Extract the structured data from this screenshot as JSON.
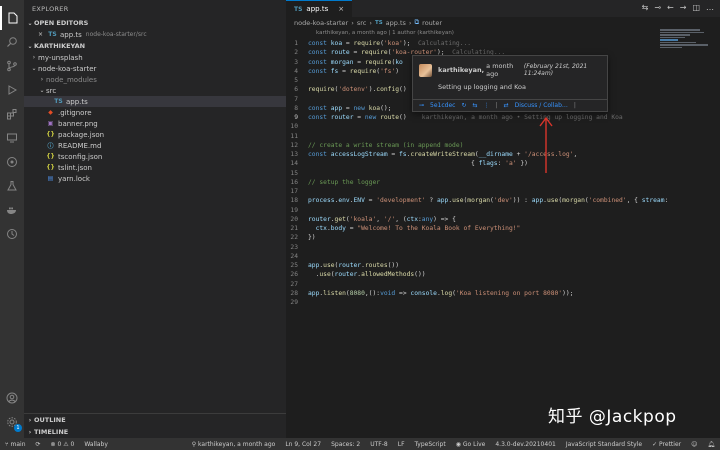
{
  "sidebar": {
    "title": "EXPLORER",
    "open_editors_label": "OPEN EDITORS",
    "open_file": {
      "name": "app.ts",
      "path": "node-koa-starter/src"
    },
    "workspace_label": "KARTHIKEYAN",
    "tree": [
      {
        "label": "my-unsplash",
        "kind": "folder",
        "depth": 1,
        "caret": "›"
      },
      {
        "label": "node-koa-starter",
        "kind": "folder",
        "depth": 1,
        "caret": "⌄"
      },
      {
        "label": "node_modules",
        "kind": "folder",
        "depth": 2,
        "caret": "›",
        "dim": true
      },
      {
        "label": "src",
        "kind": "folder",
        "depth": 2,
        "caret": "⌄"
      },
      {
        "label": "app.ts",
        "kind": "ts",
        "depth": 3,
        "selected": true
      },
      {
        "label": ".gitignore",
        "kind": "git",
        "depth": 2
      },
      {
        "label": "banner.png",
        "kind": "image",
        "depth": 2
      },
      {
        "label": "package.json",
        "kind": "json",
        "depth": 2
      },
      {
        "label": "README.md",
        "kind": "info",
        "depth": 2
      },
      {
        "label": "tsconfig.json",
        "kind": "json",
        "depth": 2
      },
      {
        "label": "tslint.json",
        "kind": "json",
        "depth": 2
      },
      {
        "label": "yarn.lock",
        "kind": "lock",
        "depth": 2
      }
    ],
    "outline_label": "OUTLINE",
    "timeline_label": "TIMELINE"
  },
  "editor": {
    "tab_label": "app.ts",
    "tab_close": "×",
    "breadcrumb": [
      "node-koa-starter",
      "src",
      "app.ts",
      "router"
    ],
    "blame_header": "karthikeyan, a month ago | 1 author (karthikeyan)",
    "lines": [
      {
        "n": "1",
        "t": "const koa = require('koa');  Calculating..."
      },
      {
        "n": "2",
        "t": "const route = require('koa-router');  Calculating..."
      },
      {
        "n": "3",
        "t": "const morgan = require('ko"
      },
      {
        "n": "4",
        "t": "const fs = require('fs')"
      },
      {
        "n": "5",
        "t": ""
      },
      {
        "n": "6",
        "t": "require('dotenv').config()"
      },
      {
        "n": "7",
        "t": ""
      },
      {
        "n": "8",
        "t": "const app = new koa();"
      },
      {
        "n": "9",
        "t": "const router = new route()",
        "ghost": "    karthikeyan, a month ago • Setting up logging and Koa",
        "current": true
      },
      {
        "n": "10",
        "t": ""
      },
      {
        "n": "11",
        "t": ""
      },
      {
        "n": "12",
        "t": "// create a write stream (in append mode)"
      },
      {
        "n": "13",
        "t": "const accessLogStream = fs.createWriteStream(__dirname + '/access.log',"
      },
      {
        "n": "14",
        "t": "                                           { flags: 'a' })"
      },
      {
        "n": "15",
        "t": ""
      },
      {
        "n": "16",
        "t": "// setup the logger"
      },
      {
        "n": "17",
        "t": ""
      },
      {
        "n": "18",
        "t": "process.env.ENV = 'development' ? app.use(morgan('dev')) : app.use(morgan('combined', { stream:"
      },
      {
        "n": "19",
        "t": ""
      },
      {
        "n": "20",
        "t": "router.get('koala', '/', (ctx:any) => {"
      },
      {
        "n": "21",
        "t": "  ctx.body = \"Welcome! To the Koala Book of Everything!\""
      },
      {
        "n": "22",
        "t": "})"
      },
      {
        "n": "23",
        "t": ""
      },
      {
        "n": "24",
        "t": ""
      },
      {
        "n": "25",
        "t": "app.use(router.routes())"
      },
      {
        "n": "26",
        "t": "  .use(router.allowedMethods())"
      },
      {
        "n": "27",
        "t": ""
      },
      {
        "n": "28",
        "t": "app.listen(8080,():void => console.log('Koa listening on port 8080'));"
      },
      {
        "n": "29",
        "t": ""
      }
    ]
  },
  "hover": {
    "author": "karthikeyan,",
    "relative": "a month ago",
    "date": "(February 21st, 2021 11:24am)",
    "message": "Setting up logging and Koa",
    "commit": "5e1cdec",
    "discuss": "Discuss / Collab…"
  },
  "status": {
    "branch": "main",
    "problems": "0 ⚠ 0",
    "wallaby": "Wallaby",
    "blame": "karthikeyan, a month ago",
    "position": "Ln 9, Col 27",
    "spaces": "Spaces: 2",
    "encoding": "UTF-8",
    "eol": "LF",
    "language": "TypeScript",
    "golive": "Go Live",
    "version": "4.3.0-dev.20210401",
    "style": "JavaScript Standard Style",
    "prettier": "Prettier"
  },
  "watermark": "知乎 @Jackpop",
  "colors": {
    "accent": "#007acc",
    "arrow": "#d9352b",
    "link": "#3794ff"
  }
}
